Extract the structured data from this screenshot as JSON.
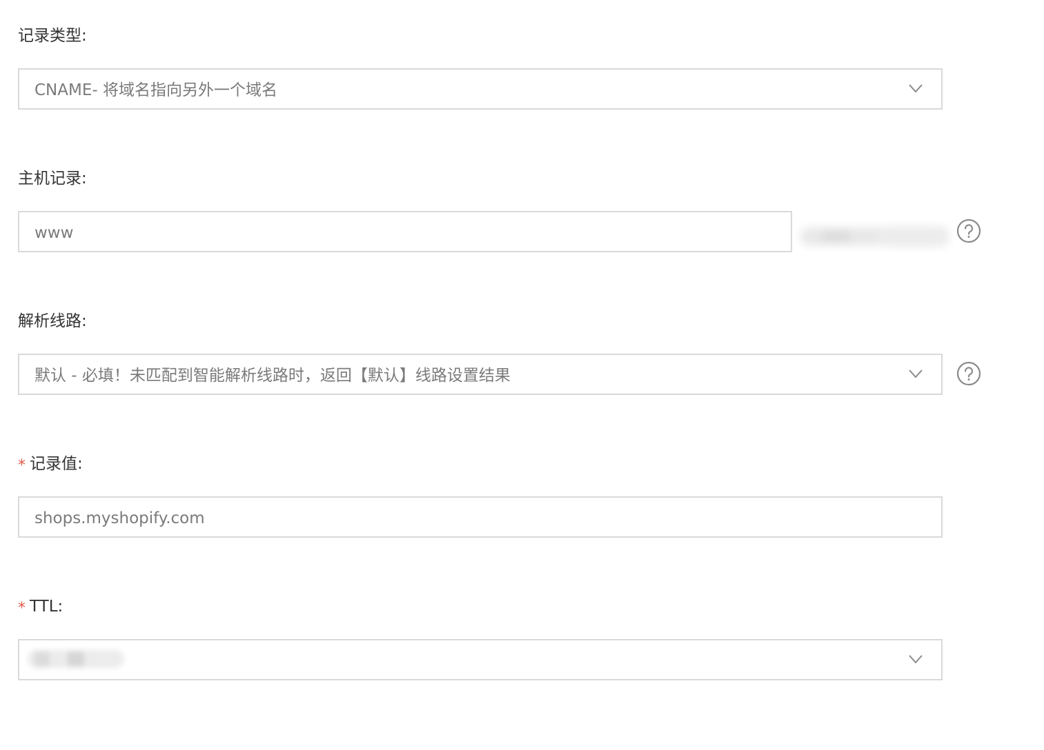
{
  "record_type": {
    "label": "记录类型:",
    "value": "CNAME- 将域名指向另外一个域名"
  },
  "host_record": {
    "label": "主机记录:",
    "value": "www"
  },
  "resolution_line": {
    "label": "解析线路:",
    "value": "默认 - 必填！未匹配到智能解析线路时，返回【默认】线路设置结果"
  },
  "record_value": {
    "required_mark": "*",
    "label": "记录值:",
    "value": "shops.myshopify.com"
  },
  "ttl": {
    "required_mark": "*",
    "label": "TTL:",
    "value": ""
  },
  "icons": {
    "dropdown": "chevron-down-icon",
    "help": "question-circle-icon"
  },
  "colors": {
    "border": "#d9d9d9",
    "label_text": "#333333",
    "value_text": "#7a7a7a",
    "required": "#e05a4a",
    "icon": "#8a8a8a"
  }
}
